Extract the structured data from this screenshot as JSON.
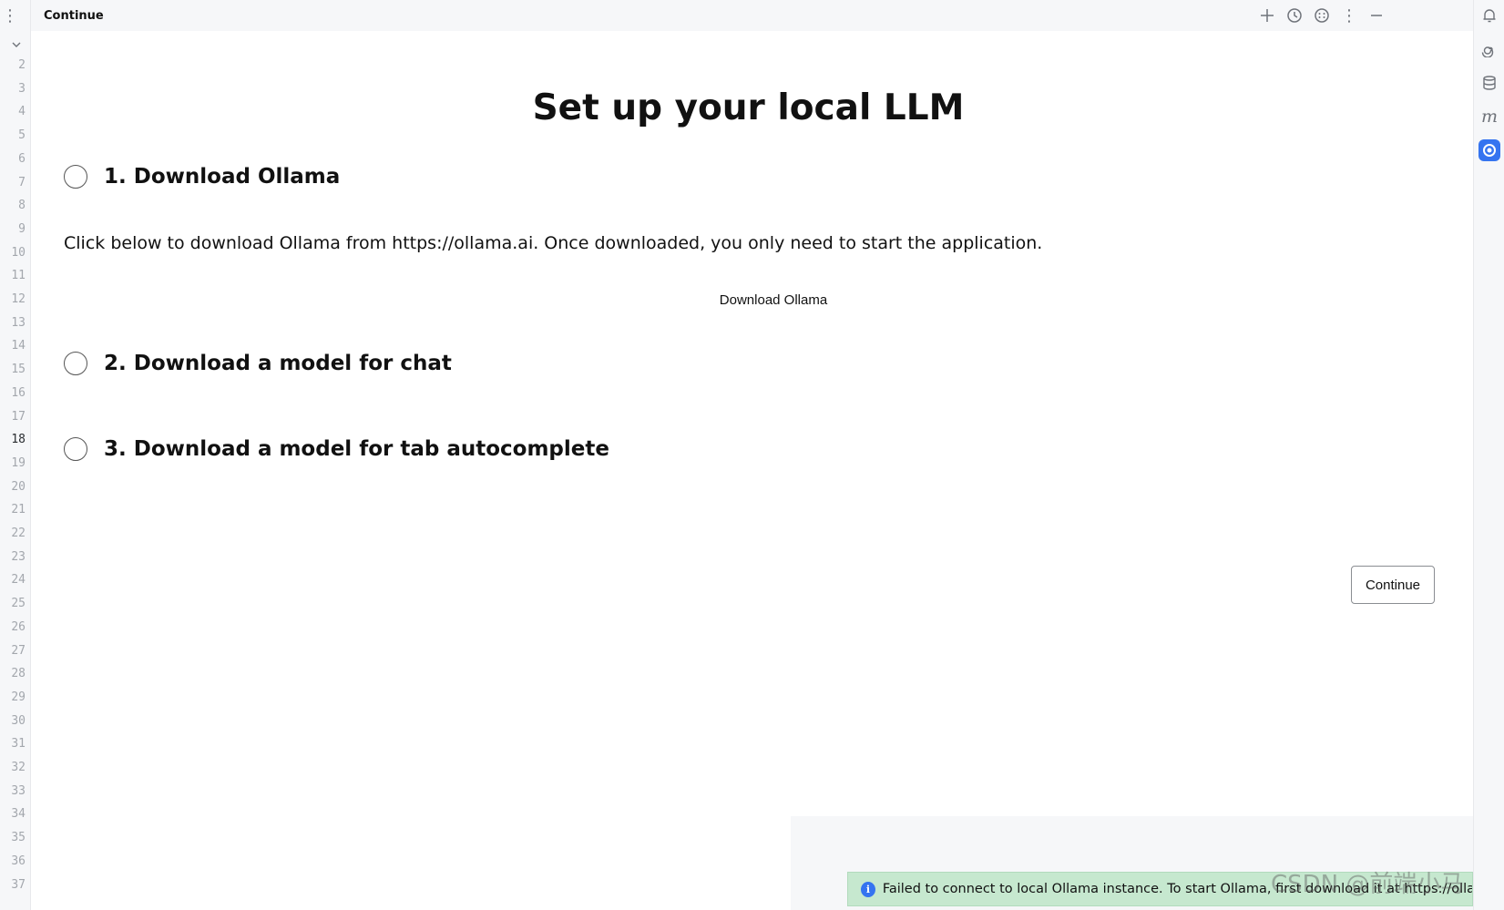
{
  "titlebar": {
    "title": "Continue",
    "icons": [
      "plus-icon",
      "history-icon",
      "smiley-icon",
      "more-vertical-icon",
      "minimize-icon"
    ]
  },
  "gutter": {
    "line_numbers": [
      "2",
      "3",
      "4",
      "5",
      "6",
      "7",
      "8",
      "9",
      "10",
      "11",
      "12",
      "13",
      "14",
      "15",
      "16",
      "17",
      "18",
      "19",
      "20",
      "21",
      "22",
      "23",
      "24",
      "25",
      "26",
      "27",
      "28",
      "29",
      "30",
      "31",
      "32",
      "33",
      "34",
      "35",
      "36",
      "37"
    ],
    "active_line": "18"
  },
  "right_strip": {
    "icons": [
      "bell-icon",
      "spiral-icon",
      "database-icon",
      "m-icon",
      "continue-icon"
    ]
  },
  "main": {
    "title": "Set up your local LLM",
    "steps": [
      {
        "label": "1. Download Ollama"
      },
      {
        "label": "2. Download a model for chat"
      },
      {
        "label": "3. Download a model for tab autocomplete"
      }
    ],
    "description": "Click below to download Ollama from https://ollama.ai. Once downloaded, you only need to start the application.",
    "download_button": "Download Ollama",
    "continue_button": "Continue"
  },
  "notification": {
    "message": "Failed to connect to local Ollama instance. To start Ollama, first download it at https://ollama.ai."
  },
  "watermark": "CSDN @前端小马",
  "colors": {
    "accent": "#3574f0",
    "toast_bg": "#c6e8cf",
    "panel_bg": "#f6f7f9"
  }
}
